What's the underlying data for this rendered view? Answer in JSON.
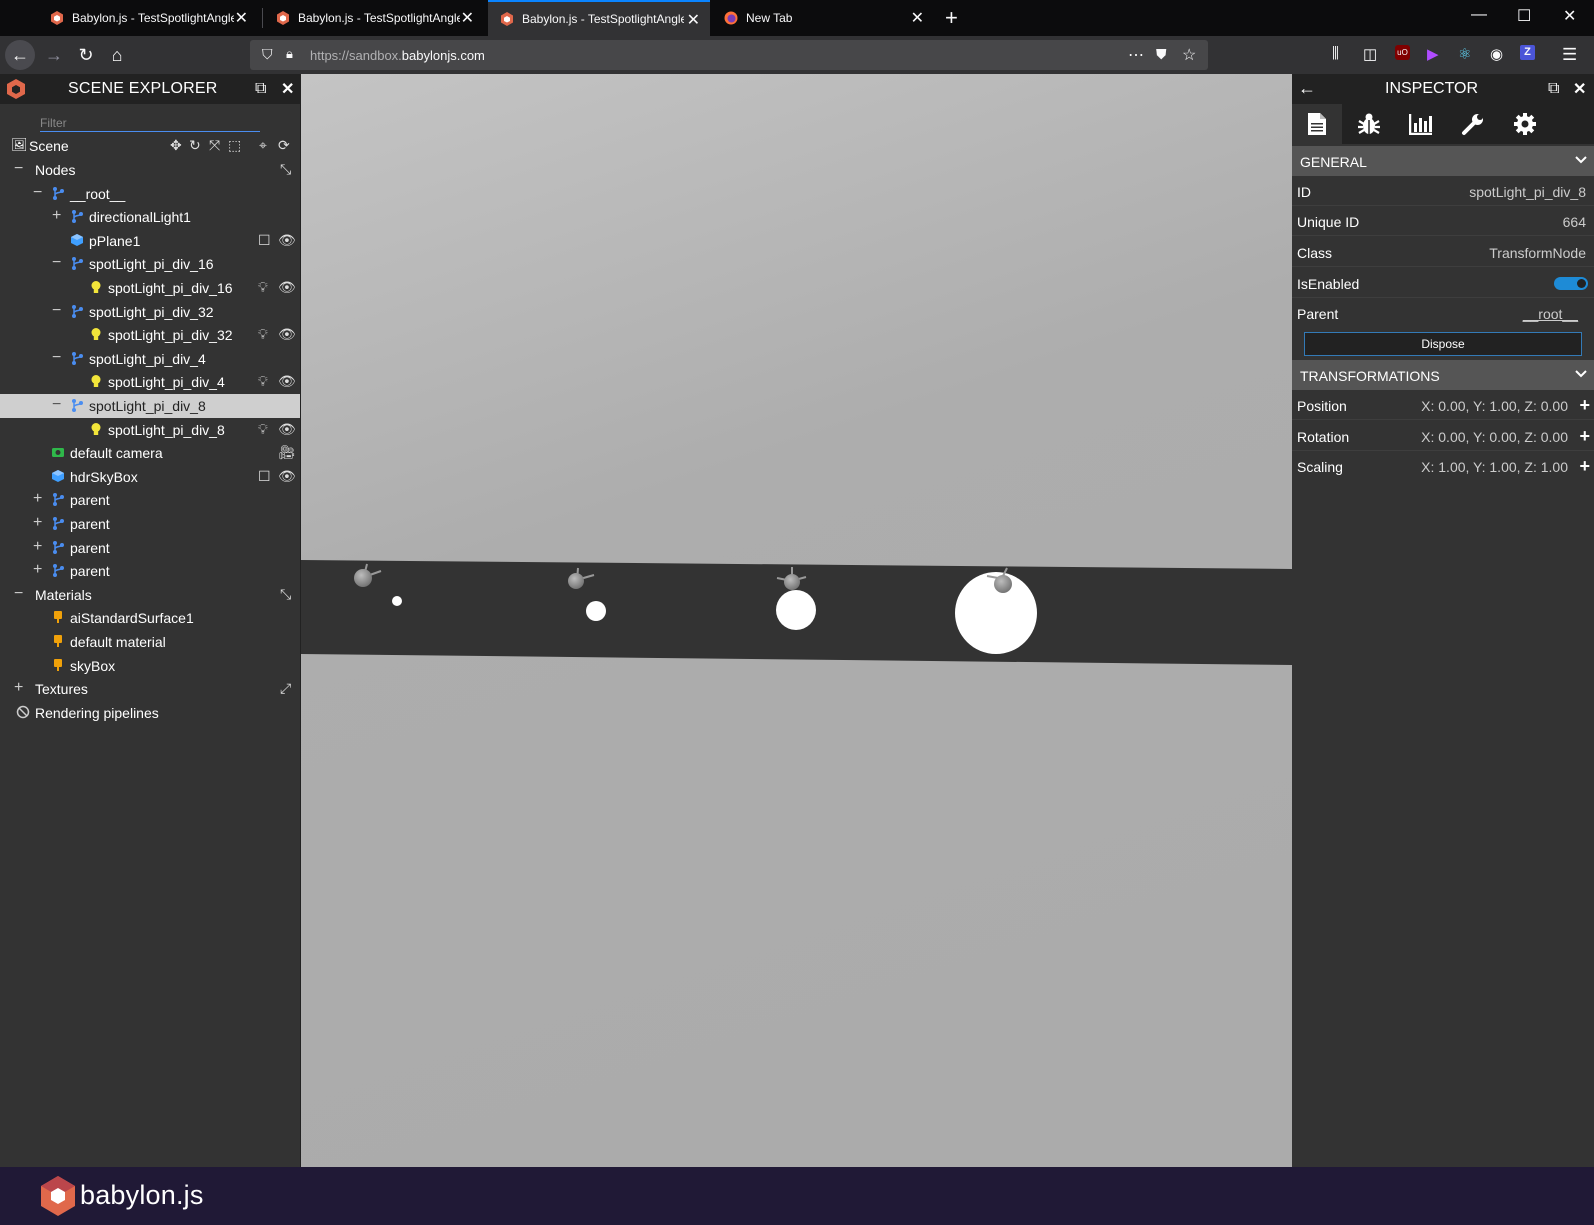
{
  "tabs": [
    {
      "title": "Babylon.js - TestSpotlightAngle",
      "active": false
    },
    {
      "title": "Babylon.js - TestSpotlightAngle",
      "active": false
    },
    {
      "title": "Babylon.js - TestSpotlightAngle",
      "active": true
    },
    {
      "title": "New Tab",
      "active": false
    }
  ],
  "urlbar": {
    "prefix": "https://sandbox.",
    "domain": "babylonjs.com"
  },
  "explorer": {
    "title": "SCENE EXPLORER",
    "filter_placeholder": "Filter",
    "scene_label": "Scene",
    "rows": [
      {
        "label": "Nodes",
        "expander": "minus",
        "kind": "section"
      },
      {
        "label": "__root__",
        "expander": "minus",
        "kind": "transform"
      },
      {
        "label": "directionalLight1",
        "expander": "plus",
        "kind": "transform"
      },
      {
        "label": "pPlane1",
        "expander": "",
        "kind": "mesh"
      },
      {
        "label": "spotLight_pi_div_16",
        "expander": "minus",
        "kind": "transform"
      },
      {
        "label": "spotLight_pi_div_16",
        "expander": "",
        "kind": "light"
      },
      {
        "label": "spotLight_pi_div_32",
        "expander": "minus",
        "kind": "transform"
      },
      {
        "label": "spotLight_pi_div_32",
        "expander": "",
        "kind": "light"
      },
      {
        "label": "spotLight_pi_div_4",
        "expander": "minus",
        "kind": "transform"
      },
      {
        "label": "spotLight_pi_div_4",
        "expander": "",
        "kind": "light"
      },
      {
        "label": "spotLight_pi_div_8",
        "expander": "minus",
        "kind": "transform",
        "selected": true
      },
      {
        "label": "spotLight_pi_div_8",
        "expander": "",
        "kind": "light"
      },
      {
        "label": "default camera",
        "expander": "",
        "kind": "camera"
      },
      {
        "label": "hdrSkyBox",
        "expander": "",
        "kind": "mesh"
      },
      {
        "label": "parent",
        "expander": "plus",
        "kind": "transform"
      },
      {
        "label": "parent",
        "expander": "plus",
        "kind": "transform"
      },
      {
        "label": "parent",
        "expander": "plus",
        "kind": "transform"
      },
      {
        "label": "parent",
        "expander": "plus",
        "kind": "transform"
      },
      {
        "label": "Materials",
        "expander": "minus",
        "kind": "section"
      },
      {
        "label": "aiStandardSurface1",
        "expander": "",
        "kind": "material"
      },
      {
        "label": "default material",
        "expander": "",
        "kind": "material"
      },
      {
        "label": "skyBox",
        "expander": "",
        "kind": "material"
      },
      {
        "label": "Textures",
        "expander": "plus",
        "kind": "section"
      },
      {
        "label": "Rendering pipelines",
        "expander": "",
        "kind": "pipelines"
      }
    ]
  },
  "inspector": {
    "title": "INSPECTOR",
    "general": {
      "header": "GENERAL",
      "id_label": "ID",
      "id_value": "spotLight_pi_div_8",
      "uid_label": "Unique ID",
      "uid_value": "664",
      "class_label": "Class",
      "class_value": "TransformNode",
      "enabled_label": "IsEnabled",
      "enabled": true,
      "parent_label": "Parent",
      "parent_value": "__root__",
      "dispose_label": "Dispose"
    },
    "transforms": {
      "header": "TRANSFORMATIONS",
      "position_label": "Position",
      "position_value": "X: 0.00, Y: 1.00, Z: 0.00",
      "rotation_label": "Rotation",
      "rotation_value": "X: 0.00, Y: 0.00, Z: 0.00",
      "scaling_label": "Scaling",
      "scaling_value": "X: 1.00, Y: 1.00, Z: 1.00"
    }
  },
  "footer": {
    "brand": "babylon.js"
  },
  "colors": {
    "accent": "#1e8bd6",
    "panel": "#333333",
    "header": "#222222",
    "footer": "#201936"
  }
}
